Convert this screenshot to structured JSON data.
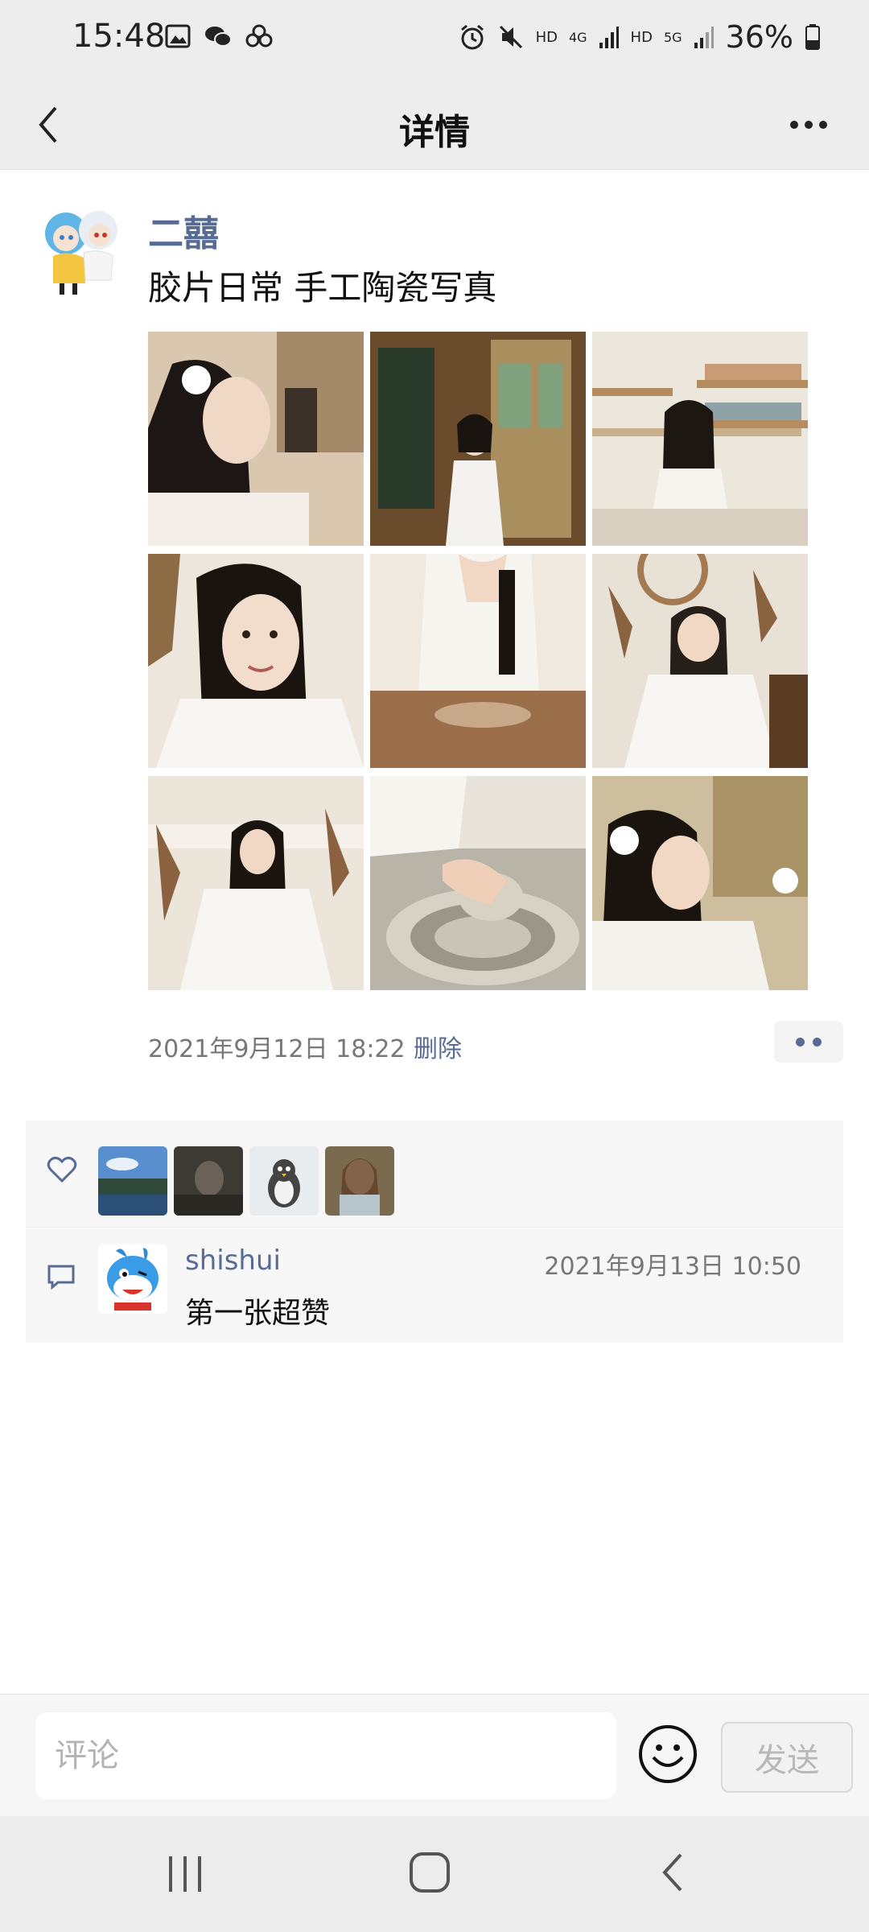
{
  "status_bar": {
    "time": "15:48",
    "battery": "36%",
    "network_labels": [
      "HD",
      "4G",
      "HD",
      "5G"
    ],
    "left_icons": [
      "image-icon",
      "wechat-icon",
      "cloud-icon"
    ],
    "right_icons": [
      "alarm-icon",
      "mute-icon",
      "signal-icon",
      "battery-icon"
    ]
  },
  "header": {
    "title": "详情"
  },
  "post": {
    "author": "二囍",
    "text": "胶片日常 手工陶瓷写真",
    "timestamp": "2021年9月12日 18:22",
    "delete_label": "删除",
    "photos": [
      {
        "desc": "girl profile crafting",
        "tone": "#d9c7b0"
      },
      {
        "desc": "girl standing at shop door",
        "tone": "#8a6a44"
      },
      {
        "desc": "girl at pottery shelf",
        "tone": "#e8e2d4"
      },
      {
        "desc": "girl smiling close-up",
        "tone": "#ece6dc"
      },
      {
        "desc": "girl at potter's wheel",
        "tone": "#b89a78"
      },
      {
        "desc": "girl with dried flowers",
        "tone": "#e5ded2"
      },
      {
        "desc": "girl seated by wall",
        "tone": "#e9e3d8"
      },
      {
        "desc": "hands shaping clay",
        "tone": "#b7b3a6"
      },
      {
        "desc": "girl looking down",
        "tone": "#d1c2a2"
      }
    ]
  },
  "likes": {
    "users": [
      {
        "desc": "lake landscape",
        "tone": "#3c6ea8"
      },
      {
        "desc": "dark portrait",
        "tone": "#3d3a33"
      },
      {
        "desc": "penguin toy",
        "tone": "#cfd3d6"
      },
      {
        "desc": "painted girl",
        "tone": "#7a6a4e"
      }
    ]
  },
  "comments": [
    {
      "name": "shishui",
      "time": "2021年9月13日 10:50",
      "text": "第一张超赞"
    }
  ],
  "comment_input": {
    "placeholder": "评论",
    "send_label": "发送"
  },
  "colors": {
    "link_blue": "#576b95",
    "bar_gray": "#ededed",
    "panel_gray": "#f7f7f7"
  }
}
